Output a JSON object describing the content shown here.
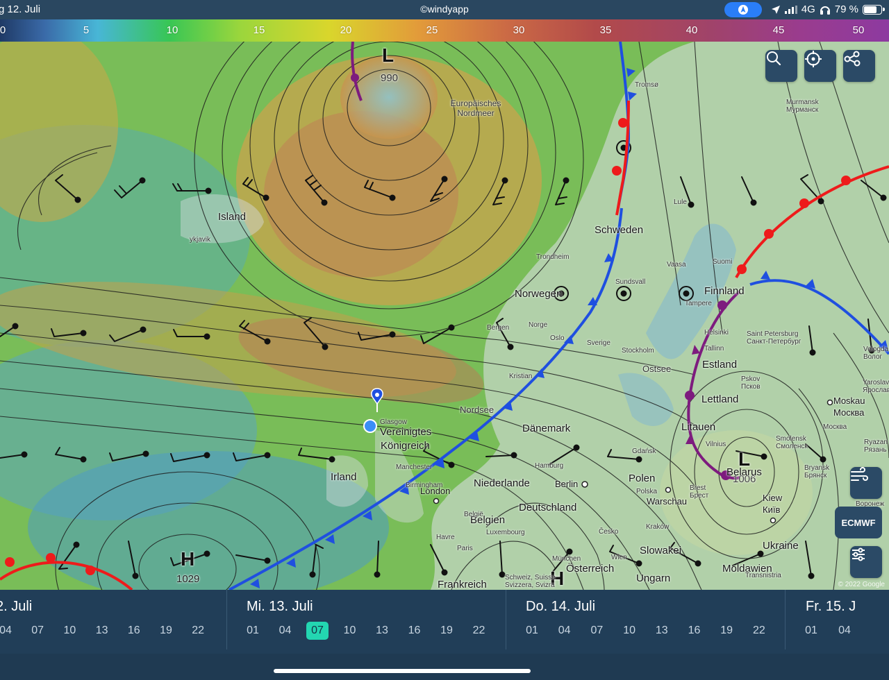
{
  "status_bar": {
    "date": "g 12. Juli",
    "brand": "©windyapp",
    "network": "4G",
    "battery": "79 %",
    "battery_level": 0.79
  },
  "wind_scale": [
    "0",
    "5",
    "10",
    "15",
    "20",
    "25",
    "30",
    "35",
    "40",
    "45",
    "50"
  ],
  "map": {
    "labels": {
      "island": "Island",
      "reykjavik": "ykjavik",
      "nordmeer": "Europäisches Nordmeer",
      "schweden": "Schweden",
      "norwegen": "Norwegen",
      "finnland": "Finnland",
      "estland": "Estland",
      "lettland": "Lettland",
      "litauen": "Litauen",
      "ostsee": "Ostsee",
      "nordsee": "Nordsee",
      "uk_line1": "Vereinigtes",
      "uk_line2": "Königreich",
      "irland": "Irland",
      "daenemark": "Dänemark",
      "niederlande": "Niederlande",
      "belgien": "Belgien",
      "deutschland": "Deutschland",
      "polen": "Polen",
      "warschau": "Warschau",
      "berlin": "Berlin",
      "london": "London",
      "belarus": "Belarus",
      "kiew": "Kiew",
      "kyiv": "Київ",
      "ukraine": "Ukraine",
      "slowakei": "Slowakei",
      "oesterreich": "Österreich",
      "ungarn": "Ungarn",
      "moldawien": "Moldawien",
      "frankreich": "Frankreich",
      "moskau": "Moskau",
      "moskva": "Москва",
      "tromso": "Tromsø",
      "murmansk": "Murmansk",
      "murmansk_ru": "Мурманск",
      "lule": "Lule",
      "vaasa": "Vaasa",
      "suomi": "Suomi",
      "trondheim": "Trondheim",
      "sundsvall": "Sundsvall",
      "norge": "Norge",
      "sverige": "Sverige",
      "bergen": "Bergen",
      "oslo": "Oslo",
      "stockholm": "Stockholm",
      "helsinki": "Helsinki",
      "tallinn": "Tallinn",
      "tampere": "Tampere",
      "saint_petersburg": "Saint Petersburg",
      "saint_petersburg_ru": "Санкт-Петербург",
      "pskov": "Pskov",
      "pskov_ru": "Псков",
      "vilnius": "Vilnius",
      "smolensk": "Smolensk",
      "smolensk_ru": "Смоленск",
      "bryansk": "Bryansk",
      "bryansk_ru": "Брянск",
      "ryazan": "Ryazan",
      "ryazan_ru": "Рязань",
      "yaroslavl": "Yaroslavl",
      "yaroslavl_ru": "Ярославль",
      "vologda": "Vologda",
      "vologda_ru": "Волог",
      "gdansk": "Gdańsk",
      "hamburg": "Hamburg",
      "glasgow": "Glasgow",
      "manchester": "Manchester",
      "birmingham": "Birmingham",
      "muenchen": "München",
      "schweiz": "Schweiz, Suisse",
      "svizzera": "Svizzera, Svizra",
      "lux": "Luxembourg",
      "belgie": "België",
      "polska": "Polska",
      "paris": "Paris",
      "havre": "Havre",
      "voronezh": "Воронеж",
      "transnistria": "Transnistria",
      "cesko": "Česko",
      "wien": "Wien",
      "krakow": "Kraków",
      "brest": "Brest",
      "brest_ru": "Брест",
      "moskva_small": "Москва",
      "kristiansand": "Kristian"
    },
    "pressure": {
      "low1_letter": "L",
      "low1_value": "990",
      "low2_letter": "L",
      "low2_value": "1006",
      "high1_letter": "H",
      "high1_value": "1029",
      "high2_letter": "H"
    },
    "model": "ECMWF",
    "copyright": "© 2022 Google"
  },
  "timeline": {
    "days": [
      {
        "name": "2. Juli",
        "hours": [
          "04",
          "07",
          "10",
          "13",
          "16",
          "19",
          "22"
        ]
      },
      {
        "name": "Mi. 13. Juli",
        "hours": [
          "01",
          "04",
          "07",
          "10",
          "13",
          "16",
          "19",
          "22"
        ]
      },
      {
        "name": "Do. 14. Juli",
        "hours": [
          "01",
          "04",
          "07",
          "10",
          "13",
          "16",
          "19",
          "22"
        ]
      },
      {
        "name": "Fr. 15. J",
        "hours": [
          "01",
          "04"
        ]
      }
    ],
    "selected": "07"
  },
  "icons": {
    "search": "search-icon",
    "locate": "crosshair-icon",
    "share": "share-nodes-icon",
    "wind_layer": "wind-icon",
    "settings": "sliders-icon",
    "navigation": "location-arrow-icon"
  }
}
